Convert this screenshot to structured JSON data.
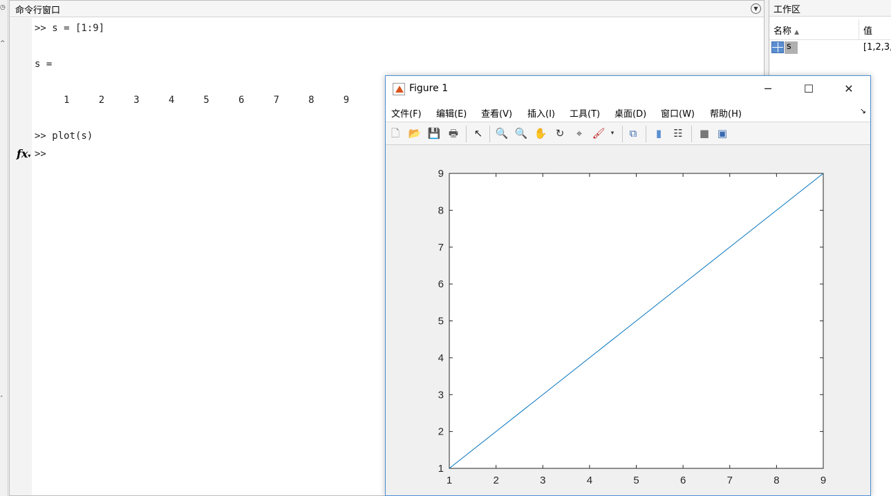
{
  "command_window": {
    "title": "命令行窗口",
    "lines": [
      ">> s = [1:9]",
      "s =",
      "     1     2     3     4     5     6     7     8     9",
      ">> plot(s)",
      ">>"
    ],
    "fx_label": "fx"
  },
  "workspace": {
    "title": "工作区",
    "col_name": "名称",
    "col_value": "值",
    "var_name": "s",
    "var_value": "[1,2,3,"
  },
  "figure": {
    "title": "Figure 1",
    "menus": [
      "文件(F)",
      "编辑(E)",
      "查看(V)",
      "插入(I)",
      "工具(T)",
      "桌面(D)",
      "窗口(W)",
      "帮助(H)"
    ],
    "line_color": "#0072BD"
  },
  "chart_data": {
    "type": "line",
    "x": [
      1,
      2,
      3,
      4,
      5,
      6,
      7,
      8,
      9
    ],
    "series": [
      {
        "values": [
          1,
          2,
          3,
          4,
          5,
          6,
          7,
          8,
          9
        ]
      }
    ],
    "xlim": [
      1,
      9
    ],
    "ylim": [
      1,
      9
    ],
    "xticks": [
      1,
      2,
      3,
      4,
      5,
      6,
      7,
      8,
      9
    ],
    "yticks": [
      1,
      2,
      3,
      4,
      5,
      6,
      7,
      8,
      9
    ],
    "grid": false,
    "title": "",
    "xlabel": "",
    "ylabel": ""
  }
}
